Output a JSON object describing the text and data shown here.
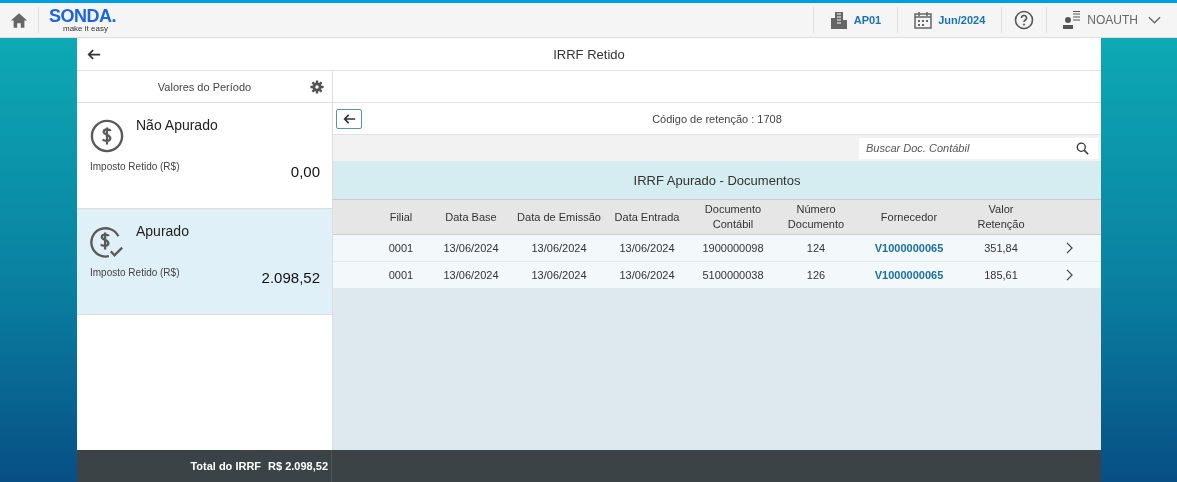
{
  "header": {
    "logo": "SONDA.",
    "tagline": "make it easy",
    "company": "AP01",
    "period": "Jun/2024",
    "user": "NOAUTH"
  },
  "page": {
    "title": "IRRF Retido"
  },
  "sidebar": {
    "title": "Valores do Período",
    "cards": [
      {
        "kind": "open",
        "title": "Não Apurado",
        "label": "Imposto Retido (R$)",
        "value": "0,00",
        "selected": false
      },
      {
        "kind": "done",
        "title": "Apurado",
        "label": "Imposto Retido (R$)",
        "value": "2.098,52",
        "selected": true
      }
    ],
    "total_label": "Total do IRRF",
    "total_value": "R$ 2.098,52"
  },
  "detail": {
    "code": "Código de retenção : 1708",
    "search": {
      "placeholder": "Buscar Doc. Contábil"
    },
    "table_title": "IRRF Apurado - Documentos",
    "columns": [
      "Filial",
      "Data Base",
      "Data de Emissão",
      "Data Entrada",
      "Documento Contábil",
      "Número Documento",
      "Fornecedor",
      "Valor Retenção"
    ],
    "rows": [
      [
        "0001",
        "13/06/2024",
        "13/06/2024",
        "13/06/2024",
        "1900000098",
        "124",
        "V1000000065",
        "351,84"
      ],
      [
        "0001",
        "13/06/2024",
        "13/06/2024",
        "13/06/2024",
        "5100000038",
        "126",
        "V1000000065",
        "185,61"
      ]
    ]
  }
}
